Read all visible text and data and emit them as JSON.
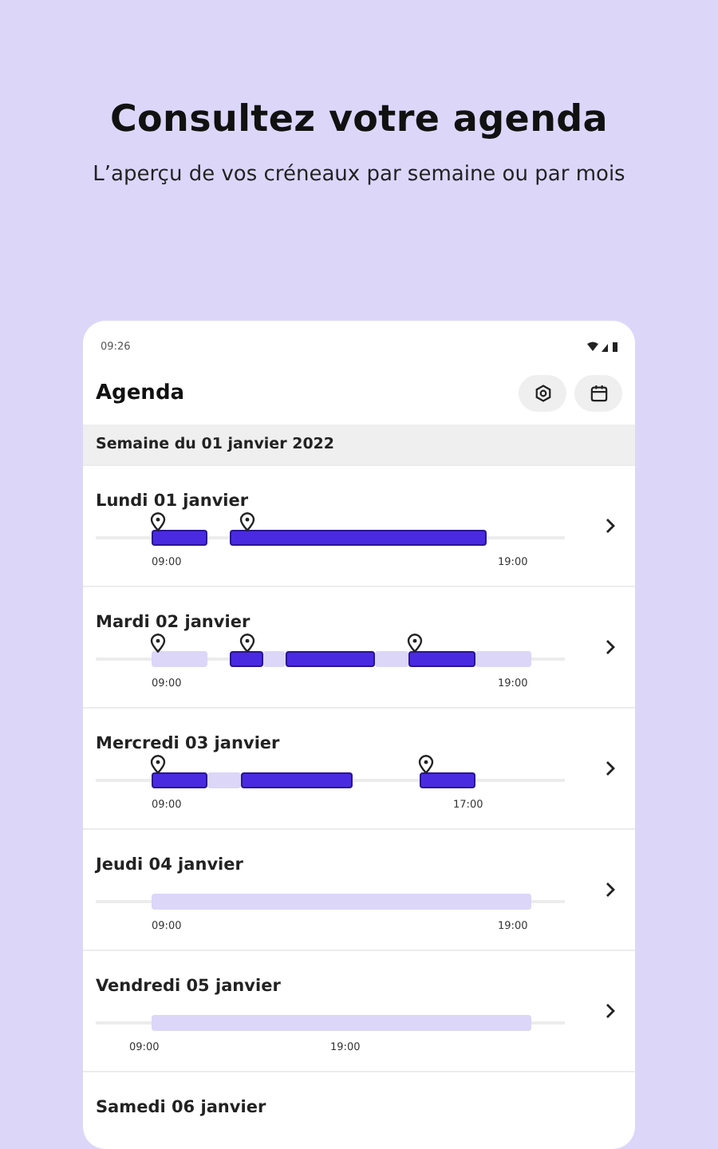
{
  "headline": "Consultez votre agenda",
  "subtitle": "L’aperçu de vos créneaux par semaine ou par mois",
  "status_bar": {
    "time": "09:26"
  },
  "app_bar": {
    "title": "Agenda"
  },
  "week_header": "Semaine du 01 janvier 2022",
  "days": [
    {
      "label": "Lundi 01 janvier",
      "slots": [
        {
          "kind": "none"
        },
        {
          "kind": "none"
        },
        {
          "kind": "none"
        },
        {
          "kind": "none"
        },
        {
          "kind": "none"
        },
        {
          "kind": "booked",
          "pin": true,
          "time": "09:00"
        },
        {
          "kind": "booked"
        },
        {
          "kind": "booked"
        },
        {
          "kind": "booked"
        },
        {
          "kind": "booked"
        },
        {
          "kind": "none"
        },
        {
          "kind": "none"
        },
        {
          "kind": "booked"
        },
        {
          "kind": "booked",
          "pin": true
        },
        {
          "kind": "booked"
        },
        {
          "kind": "booked"
        },
        {
          "kind": "booked"
        },
        {
          "kind": "booked"
        },
        {
          "kind": "booked"
        },
        {
          "kind": "booked"
        },
        {
          "kind": "booked"
        },
        {
          "kind": "booked"
        },
        {
          "kind": "booked"
        },
        {
          "kind": "booked"
        },
        {
          "kind": "booked"
        },
        {
          "kind": "booked"
        },
        {
          "kind": "booked"
        },
        {
          "kind": "booked"
        },
        {
          "kind": "booked"
        },
        {
          "kind": "booked"
        },
        {
          "kind": "booked"
        },
        {
          "kind": "booked"
        },
        {
          "kind": "booked"
        },
        {
          "kind": "booked"
        },
        {
          "kind": "booked"
        },
        {
          "kind": "none"
        },
        {
          "kind": "none",
          "time": "19:00"
        },
        {
          "kind": "none"
        },
        {
          "kind": "none"
        },
        {
          "kind": "none"
        },
        {
          "kind": "none"
        },
        {
          "kind": "none"
        }
      ]
    },
    {
      "label": "Mardi 02 janvier",
      "slots": [
        {
          "kind": "none"
        },
        {
          "kind": "none"
        },
        {
          "kind": "none"
        },
        {
          "kind": "none"
        },
        {
          "kind": "none"
        },
        {
          "kind": "free",
          "pin": true,
          "time": "09:00"
        },
        {
          "kind": "free"
        },
        {
          "kind": "free"
        },
        {
          "kind": "free"
        },
        {
          "kind": "free"
        },
        {
          "kind": "none"
        },
        {
          "kind": "none"
        },
        {
          "kind": "booked"
        },
        {
          "kind": "booked",
          "pin": true
        },
        {
          "kind": "booked"
        },
        {
          "kind": "free"
        },
        {
          "kind": "free"
        },
        {
          "kind": "booked"
        },
        {
          "kind": "booked"
        },
        {
          "kind": "booked"
        },
        {
          "kind": "booked"
        },
        {
          "kind": "booked"
        },
        {
          "kind": "booked"
        },
        {
          "kind": "booked"
        },
        {
          "kind": "booked"
        },
        {
          "kind": "free"
        },
        {
          "kind": "free"
        },
        {
          "kind": "free"
        },
        {
          "kind": "booked",
          "pin": true
        },
        {
          "kind": "booked"
        },
        {
          "kind": "booked"
        },
        {
          "kind": "booked"
        },
        {
          "kind": "booked"
        },
        {
          "kind": "booked"
        },
        {
          "kind": "free"
        },
        {
          "kind": "free"
        },
        {
          "kind": "free",
          "time": "19:00"
        },
        {
          "kind": "free"
        },
        {
          "kind": "free"
        },
        {
          "kind": "none"
        },
        {
          "kind": "none"
        },
        {
          "kind": "none"
        }
      ]
    },
    {
      "label": "Mercredi 03 janvier",
      "slots": [
        {
          "kind": "none"
        },
        {
          "kind": "none"
        },
        {
          "kind": "none"
        },
        {
          "kind": "none"
        },
        {
          "kind": "none"
        },
        {
          "kind": "booked",
          "pin": true,
          "time": "09:00"
        },
        {
          "kind": "booked"
        },
        {
          "kind": "booked"
        },
        {
          "kind": "booked"
        },
        {
          "kind": "booked"
        },
        {
          "kind": "free"
        },
        {
          "kind": "free"
        },
        {
          "kind": "free"
        },
        {
          "kind": "booked"
        },
        {
          "kind": "booked"
        },
        {
          "kind": "booked"
        },
        {
          "kind": "booked"
        },
        {
          "kind": "booked"
        },
        {
          "kind": "booked"
        },
        {
          "kind": "booked"
        },
        {
          "kind": "booked"
        },
        {
          "kind": "booked"
        },
        {
          "kind": "booked"
        },
        {
          "kind": "none"
        },
        {
          "kind": "none"
        },
        {
          "kind": "none"
        },
        {
          "kind": "none"
        },
        {
          "kind": "none"
        },
        {
          "kind": "none"
        },
        {
          "kind": "booked",
          "pin": true
        },
        {
          "kind": "booked"
        },
        {
          "kind": "booked"
        },
        {
          "kind": "booked",
          "time": "17:00"
        },
        {
          "kind": "booked"
        },
        {
          "kind": "none"
        },
        {
          "kind": "none"
        },
        {
          "kind": "none"
        },
        {
          "kind": "none"
        },
        {
          "kind": "none"
        },
        {
          "kind": "none"
        },
        {
          "kind": "none"
        },
        {
          "kind": "none"
        }
      ]
    },
    {
      "label": "Jeudi 04 janvier",
      "slots": [
        {
          "kind": "none"
        },
        {
          "kind": "none"
        },
        {
          "kind": "none"
        },
        {
          "kind": "none"
        },
        {
          "kind": "none"
        },
        {
          "kind": "free",
          "time": "09:00"
        },
        {
          "kind": "free"
        },
        {
          "kind": "free"
        },
        {
          "kind": "free"
        },
        {
          "kind": "free"
        },
        {
          "kind": "free"
        },
        {
          "kind": "free"
        },
        {
          "kind": "free"
        },
        {
          "kind": "free"
        },
        {
          "kind": "free"
        },
        {
          "kind": "free"
        },
        {
          "kind": "free"
        },
        {
          "kind": "free"
        },
        {
          "kind": "free"
        },
        {
          "kind": "free"
        },
        {
          "kind": "free"
        },
        {
          "kind": "free"
        },
        {
          "kind": "free"
        },
        {
          "kind": "free"
        },
        {
          "kind": "free"
        },
        {
          "kind": "free"
        },
        {
          "kind": "free"
        },
        {
          "kind": "free"
        },
        {
          "kind": "free"
        },
        {
          "kind": "free"
        },
        {
          "kind": "free"
        },
        {
          "kind": "free"
        },
        {
          "kind": "free"
        },
        {
          "kind": "free"
        },
        {
          "kind": "free"
        },
        {
          "kind": "free"
        },
        {
          "kind": "free",
          "time": "19:00"
        },
        {
          "kind": "free"
        },
        {
          "kind": "free"
        },
        {
          "kind": "none"
        },
        {
          "kind": "none"
        },
        {
          "kind": "none"
        }
      ]
    },
    {
      "label": "Vendredi 05 janvier",
      "slots": [
        {
          "kind": "none"
        },
        {
          "kind": "none"
        },
        {
          "kind": "none"
        },
        {
          "kind": "none",
          "time": "09:00"
        },
        {
          "kind": "none"
        },
        {
          "kind": "free"
        },
        {
          "kind": "free"
        },
        {
          "kind": "free"
        },
        {
          "kind": "free"
        },
        {
          "kind": "free"
        },
        {
          "kind": "free"
        },
        {
          "kind": "free"
        },
        {
          "kind": "free"
        },
        {
          "kind": "free"
        },
        {
          "kind": "free"
        },
        {
          "kind": "free"
        },
        {
          "kind": "free"
        },
        {
          "kind": "free"
        },
        {
          "kind": "free"
        },
        {
          "kind": "free"
        },
        {
          "kind": "free"
        },
        {
          "kind": "free",
          "time": "19:00"
        },
        {
          "kind": "free"
        },
        {
          "kind": "free"
        },
        {
          "kind": "free"
        },
        {
          "kind": "free"
        },
        {
          "kind": "free"
        },
        {
          "kind": "free"
        },
        {
          "kind": "free"
        },
        {
          "kind": "free"
        },
        {
          "kind": "free"
        },
        {
          "kind": "free"
        },
        {
          "kind": "free"
        },
        {
          "kind": "free"
        },
        {
          "kind": "free"
        },
        {
          "kind": "free"
        },
        {
          "kind": "free"
        },
        {
          "kind": "free"
        },
        {
          "kind": "free"
        },
        {
          "kind": "none"
        },
        {
          "kind": "none"
        },
        {
          "kind": "none"
        }
      ]
    },
    {
      "label": "Samedi 06 janvier"
    }
  ]
}
